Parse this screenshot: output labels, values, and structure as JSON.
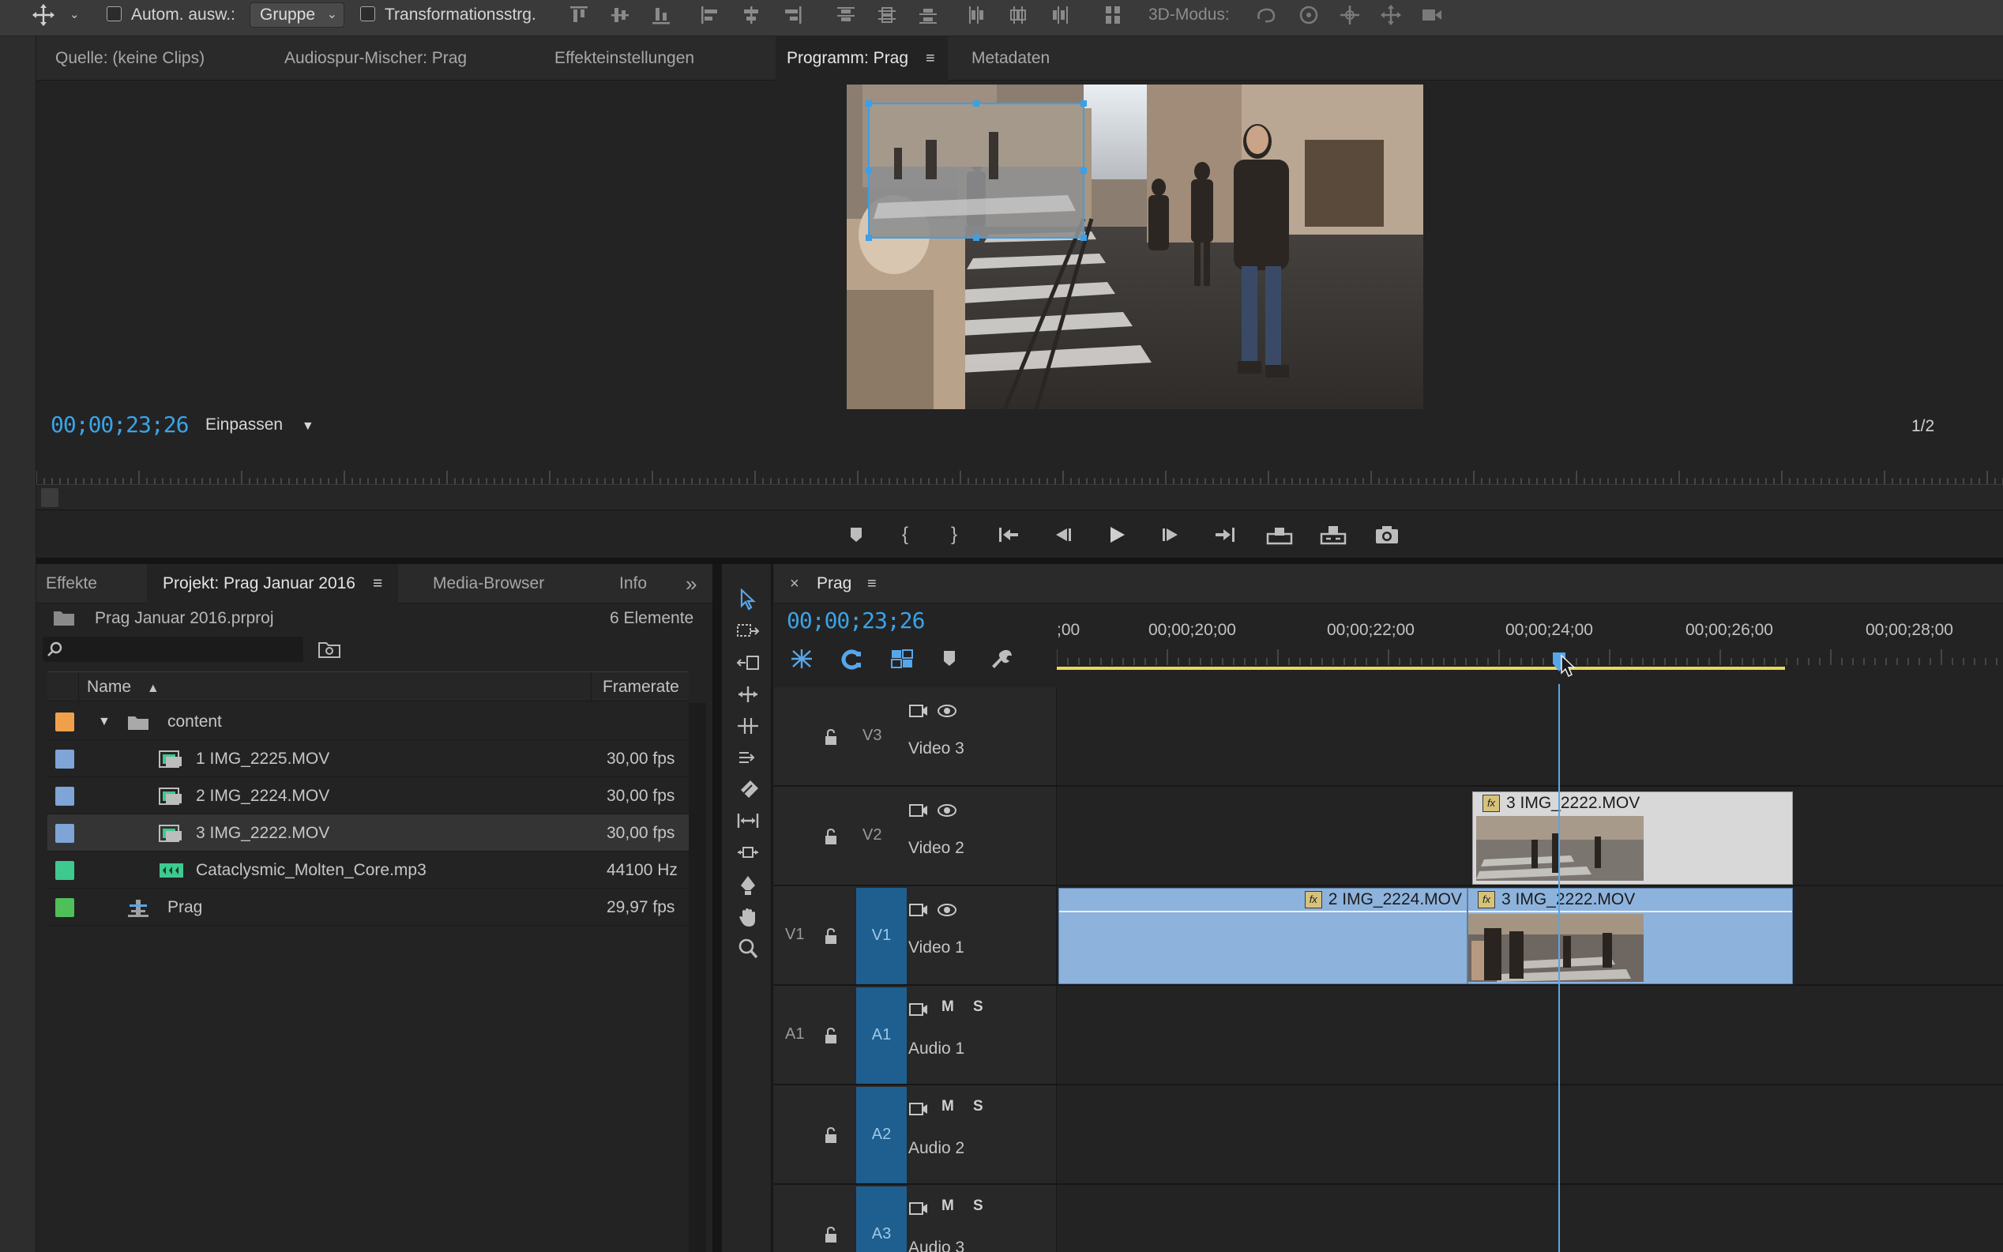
{
  "topbar": {
    "auto_select_label": "Autom. ausw.:",
    "group_value": "Gruppe",
    "transform_label": "Transformationsstrg.",
    "mode3d_label": "3D-Modus:"
  },
  "monitor": {
    "tabs": [
      {
        "label": "Quelle: (keine Clips)"
      },
      {
        "label": "Audiospur-Mischer: Prag"
      },
      {
        "label": "Effekteinstellungen"
      },
      {
        "label": "Programm: Prag"
      },
      {
        "label": "Metadaten"
      }
    ],
    "menu_glyph": "≡",
    "timecode": "00;00;23;26",
    "fit_value": "Einpassen",
    "resolution": "1/2"
  },
  "project": {
    "tabs": [
      {
        "label": "Effekte"
      },
      {
        "label": "Projekt: Prag Januar 2016"
      },
      {
        "label": "Media-Browser"
      },
      {
        "label": "Info"
      }
    ],
    "overflow_glyph": "»",
    "filename": "Prag Januar 2016.prproj",
    "item_count": "6 Elemente",
    "col_name": "Name",
    "col_framerate": "Framerate",
    "rows": [
      {
        "name": "content",
        "rate": "",
        "color": "#f0a04b",
        "type": "folder"
      },
      {
        "name": "1 IMG_2225.MOV",
        "rate": "30,00 fps",
        "color": "#7ea4d8",
        "type": "clip"
      },
      {
        "name": "2 IMG_2224.MOV",
        "rate": "30,00 fps",
        "color": "#7ea4d8",
        "type": "clip"
      },
      {
        "name": "3 IMG_2222.MOV",
        "rate": "30,00 fps",
        "color": "#7ea4d8",
        "type": "clip"
      },
      {
        "name": "Cataclysmic_Molten_Core.mp3",
        "rate": "44100  Hz",
        "color": "#3ec98e",
        "type": "audio"
      },
      {
        "name": "Prag",
        "rate": "29,97 fps",
        "color": "#4fbf5a",
        "type": "sequence"
      }
    ]
  },
  "timeline": {
    "close_glyph": "×",
    "sequence_name": "Prag",
    "menu_glyph": "≡",
    "timecode": "00;00;23;26",
    "ruler_labels": [
      {
        "label": ";00"
      },
      {
        "label": "00;00;20;00"
      },
      {
        "label": "00;00;22;00"
      },
      {
        "label": "00;00;24;00"
      },
      {
        "label": "00;00;26;00"
      },
      {
        "label": "00;00;28;00"
      }
    ],
    "tracks": [
      {
        "id": "",
        "sel": "V3",
        "name": "Video 3"
      },
      {
        "id": "",
        "sel": "V2",
        "name": "Video 2"
      },
      {
        "id": "V1",
        "sel": "V1",
        "name": "Video 1"
      },
      {
        "id": "A1",
        "sel": "A1",
        "name": "Audio 1"
      },
      {
        "id": "",
        "sel": "A2",
        "name": "Audio 2"
      },
      {
        "id": "",
        "sel": "A3",
        "name": "Audio 3"
      }
    ],
    "mute_label": "M",
    "solo_label": "S",
    "clips": {
      "v2_clip": "3 IMG_2222.MOV",
      "v1_clip_a": "2 IMG_2224.MOV",
      "v1_clip_b": "3 IMG_2222.MOV"
    },
    "fx_label": "fx"
  },
  "colors": {
    "accent": "#3ba3e6",
    "clip_blue": "#8db3dd",
    "clip_grey": "#d8d8d8",
    "selected_track": "#1e5f8f",
    "workarea_yellow": "#e8d85a"
  }
}
